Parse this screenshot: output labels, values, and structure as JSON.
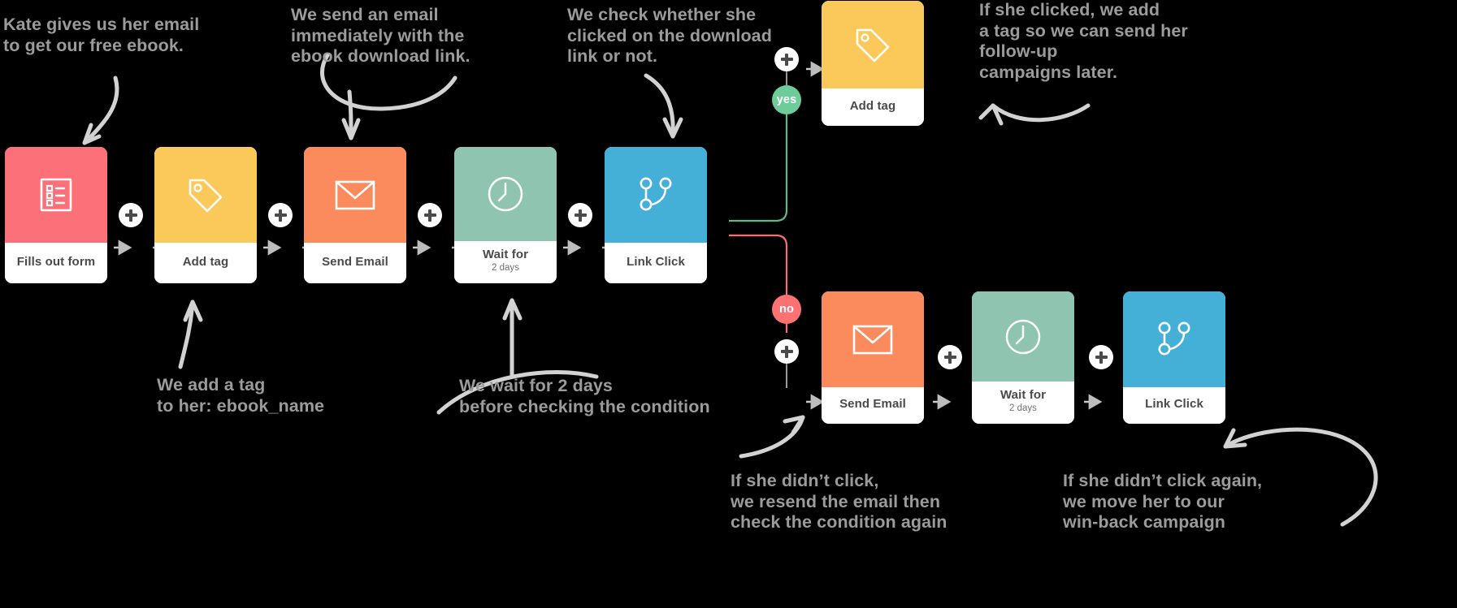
{
  "meta": {
    "title": "Email automation workflow diagram",
    "background_color": "#000000",
    "note_color": "#9b9b9b",
    "arrow_color": "#d5d5d5"
  },
  "palette": {
    "form": "#fc7179",
    "tag": "#fbc85a",
    "email": "#fb8a5c",
    "wait": "#8ec4b0",
    "link": "#44b0d8",
    "yes": "#6ecb9a",
    "no": "#fc7272",
    "card_body": "#ffffff",
    "label_text": "#4a4a4a"
  },
  "cards": {
    "fills_out_form": {
      "label": "Fills out form",
      "sub": "",
      "icon": "form-list-icon",
      "color": "#fc7179"
    },
    "add_tag_main": {
      "label": "Add tag",
      "sub": "",
      "icon": "tag-icon",
      "color": "#fbc85a"
    },
    "send_email_main": {
      "label": "Send Email",
      "sub": "",
      "icon": "envelope-icon",
      "color": "#fb8a5c"
    },
    "wait_main": {
      "label": "Wait for",
      "sub": "2 days",
      "icon": "clock-icon",
      "color": "#8ec4b0"
    },
    "link_click_main": {
      "label": "Link Click",
      "sub": "",
      "icon": "branch-icon",
      "color": "#44b0d8"
    },
    "add_tag_yes": {
      "label": "Add tag",
      "sub": "",
      "icon": "tag-icon",
      "color": "#fbc85a"
    },
    "send_email_no": {
      "label": "Send Email",
      "sub": "",
      "icon": "envelope-icon",
      "color": "#fb8a5c"
    },
    "wait_no": {
      "label": "Wait for",
      "sub": "2 days",
      "icon": "clock-icon",
      "color": "#8ec4b0"
    },
    "link_click_no": {
      "label": "Link Click",
      "sub": "",
      "icon": "branch-icon",
      "color": "#44b0d8"
    }
  },
  "branches": {
    "yes_label": "yes",
    "no_label": "no"
  },
  "notes": {
    "n1": "Kate gives us her email\nto get our free ebook.",
    "n2": "We send an email\nimmediately with the\nebook download link.",
    "n3": "We check whether she\nclicked on the download\nlink or not.",
    "n4": "If she clicked, we add\na tag so we can send her\nfollow-up\ncampaigns later.",
    "n5": "We add a tag\nto her: ebook_name",
    "n6": "We wait for 2 days\nbefore checking the condition",
    "n7": "If she didn’t click,\nwe resend the email then\ncheck the condition again",
    "n8": "If she didn’t click again,\nwe move her to our\nwin-back campaign"
  }
}
